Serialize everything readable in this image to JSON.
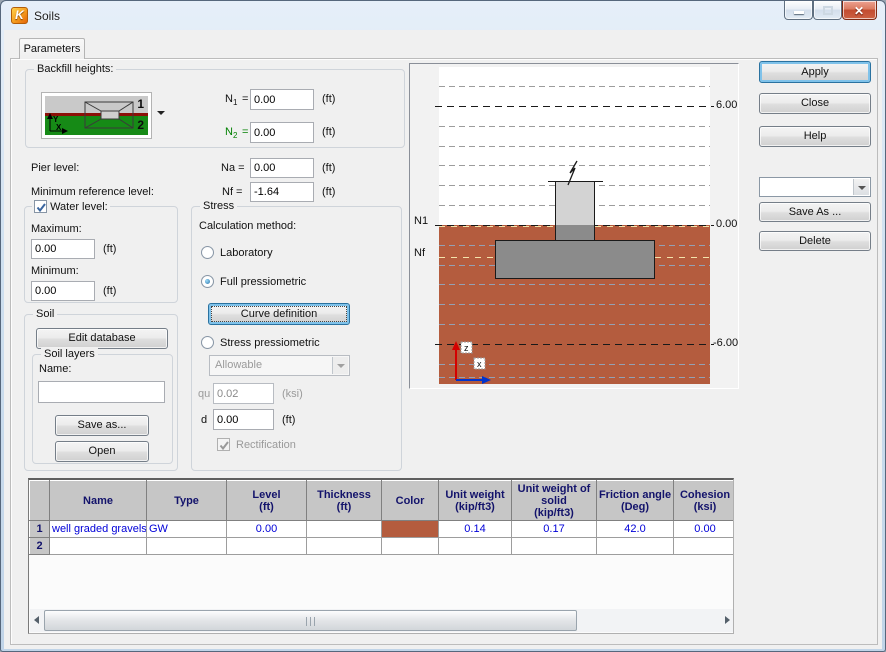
{
  "colors": {
    "soil": "#b45c3e",
    "focus_accent": "#3c7fb1",
    "n2_green": "#008000",
    "table_text": "#0000d8",
    "table_header_text": "#13136b"
  },
  "window": {
    "title": "Soils"
  },
  "tab": {
    "label": "Parameters"
  },
  "backfill": {
    "legend": "Backfill heights:",
    "zone1": "1",
    "zone2": "2",
    "axis_y": "Y",
    "axis_x": "X",
    "n1_name": "N",
    "n1_sub": "1",
    "n1_eq": "=",
    "n1_value": "0.00",
    "n2_name": "N",
    "n2_sub": "2",
    "n2_eq": "=",
    "n2_value": "0.00",
    "unit": "(ft)"
  },
  "pier": {
    "label": "Pier level:",
    "field": "Na =",
    "value": "0.00",
    "unit": "(ft)"
  },
  "reference": {
    "label": "Minimum reference level:",
    "field": "Nf =",
    "value": "-1.64",
    "unit": "(ft)"
  },
  "water": {
    "legend": "Water level:",
    "max_label": "Maximum:",
    "max_value": "0.00",
    "min_label": "Minimum:",
    "min_value": "0.00",
    "unit": "(ft)"
  },
  "soil": {
    "legend": "Soil",
    "edit_database": "Edit database",
    "layers_legend": "Soil layers",
    "name_label": "Name:",
    "name_value": "",
    "save_as": "Save as...",
    "open": "Open"
  },
  "stress": {
    "legend": "Stress",
    "method_label": "Calculation method:",
    "laboratory": "Laboratory",
    "full_pressiometric": "Full pressiometric",
    "curve_definition": "Curve definition",
    "stress_pressiometric": "Stress pressiometric",
    "allowable": "Allowable",
    "qu_label": "qu",
    "qu_value": "0.02",
    "qu_unit": "(ksi)",
    "d_label": "d",
    "d_value": "0.00",
    "d_unit": "(ft)",
    "rectification": "Rectification"
  },
  "diagram": {
    "label_n1": "N1",
    "label_nf": "Nf",
    "level_top": "6.00",
    "level_zero": "0.00",
    "level_bottom": "-6.00",
    "axis_z": "z",
    "axis_x": "x"
  },
  "actions": {
    "apply": "Apply",
    "close": "Close",
    "help": "Help",
    "preset_value": "",
    "save_as": "Save As ...",
    "delete": "Delete"
  },
  "table": {
    "columns": [
      "",
      "Name",
      "Type",
      "Level\n(ft)",
      "Thickness\n(ft)",
      "Color",
      "Unit weight\n(kip/ft3)",
      "Unit weight of\nsolid\n(kip/ft3)",
      "Friction angle\n(Deg)",
      "Cohesion\n(ksi)"
    ],
    "rows": [
      {
        "num": "1",
        "name": "well graded gravels",
        "type": "GW",
        "level": "0.00",
        "thickness": "",
        "color": "#b45c3e",
        "unit_weight": "0.14",
        "unit_weight_solid": "0.17",
        "friction_angle": "42.0",
        "cohesion": "0.00"
      },
      {
        "num": "2",
        "name": "",
        "type": "",
        "level": "",
        "thickness": "",
        "color": "",
        "unit_weight": "",
        "unit_weight_solid": "",
        "friction_angle": "",
        "cohesion": ""
      }
    ]
  }
}
